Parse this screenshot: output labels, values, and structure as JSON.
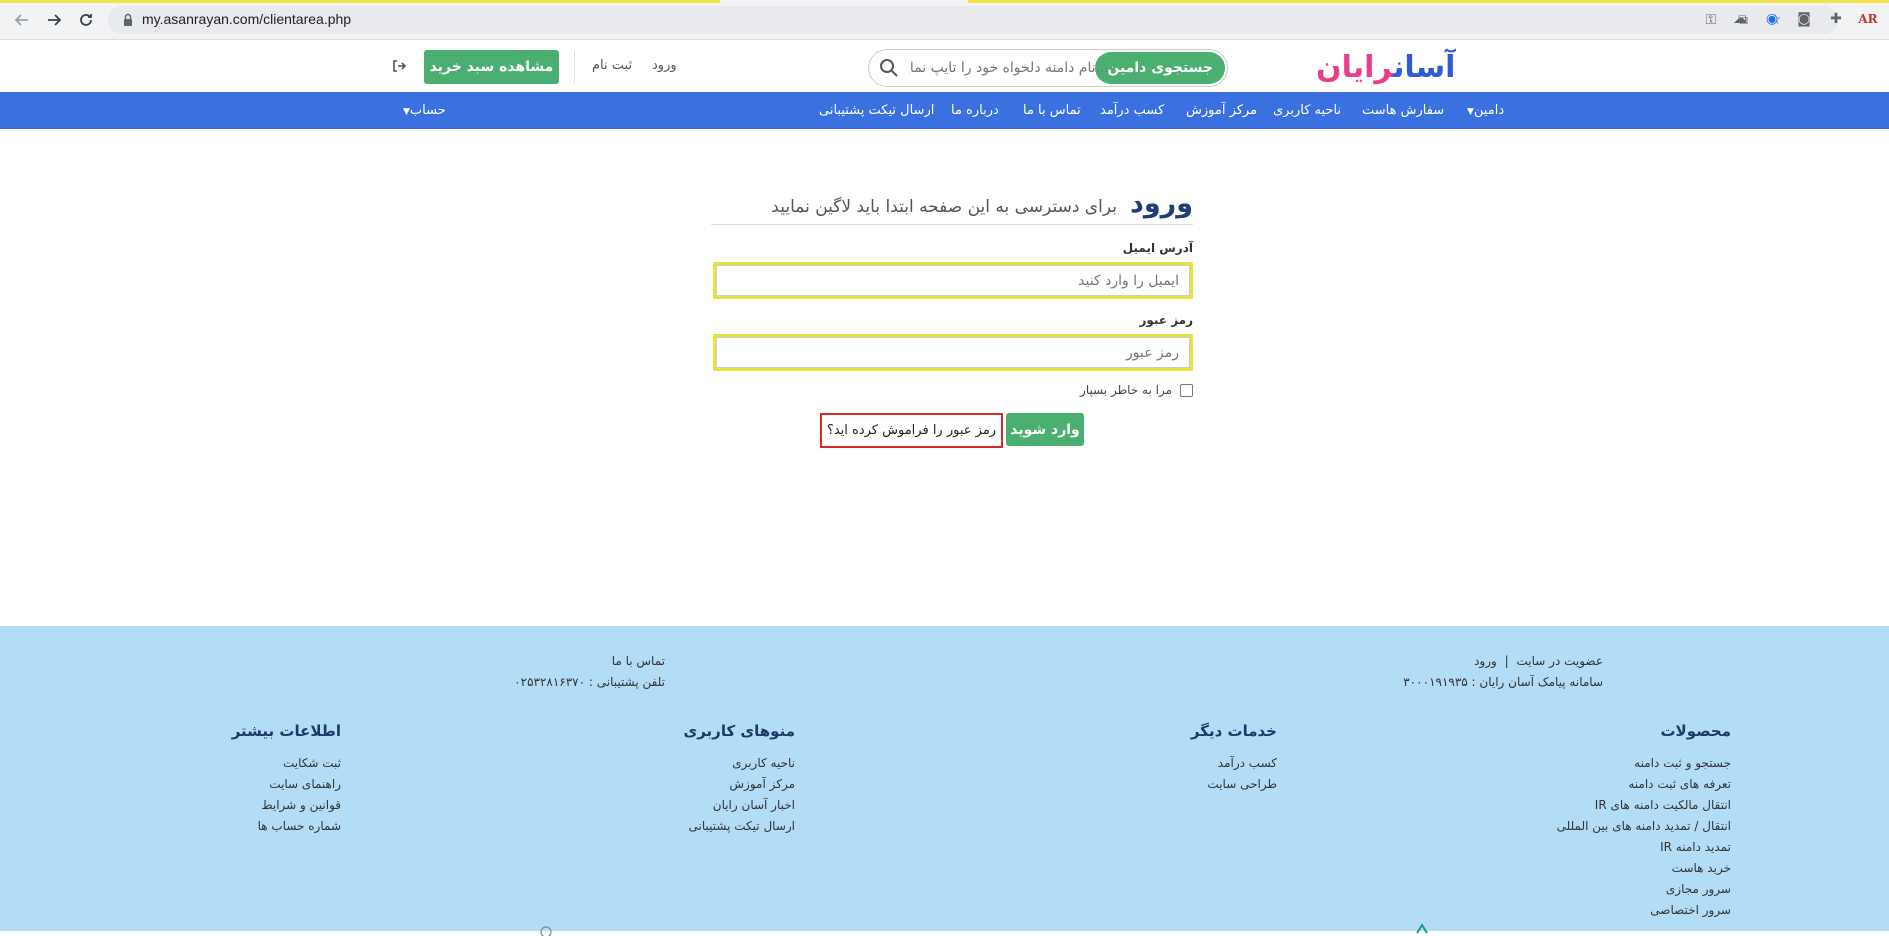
{
  "browser": {
    "url": "my.asanrayan.com/clientarea.php",
    "back_icon": "arrow-left-icon",
    "forward_icon": "arrow-right-icon",
    "reload_icon": "reload-icon"
  },
  "header": {
    "logo_text_main": "آسان",
    "logo_text_accent": "رایان",
    "search_button": "جستجوی دامین",
    "search_placeholder": "...نام دامنه دلخواه خود را تایپ نمایید",
    "login_link": "ورود",
    "register_link": "ثبت نام",
    "cart_button": "مشاهده سبد خرید"
  },
  "nav": {
    "items": [
      {
        "label": "دامین"
      },
      {
        "label": "سفارش هاست"
      },
      {
        "label": "ناحیه کاربری"
      },
      {
        "label": "مرکز آموزش"
      },
      {
        "label": "کسب درآمد"
      },
      {
        "label": "تماس با ما"
      },
      {
        "label": "درباره ما"
      },
      {
        "label": "ارسال تیکت پشتیبانی"
      }
    ],
    "account": "حساب"
  },
  "login": {
    "title": "ورود",
    "subtitle": "برای دسترسی به این صفحه ابتدا باید لاگین نمایید",
    "email_label": "آدرس ایمیل",
    "email_placeholder": "ایمیل را وارد کنید",
    "password_label": "رمز عبور",
    "password_placeholder": "رمز عبور",
    "remember_label": "مرا به خاطر بسپار",
    "submit_button": "وارد شوید",
    "forgot_button": "رمز عبور را فراموش کرده اید؟"
  },
  "footer": {
    "top_right_line1_a": "عضویت در سایت",
    "top_right_sep": "|",
    "top_right_line1_b": "ورود",
    "top_right_line2": "سامانه پیامک آسان رایان : ۳۰۰۰۱۹۱۹۳۵",
    "top_left_line1": "تماس با ما",
    "top_left_line2": "تلفن پشتیبانی : ۰۲۵۳۲۸۱۶۳۷۰",
    "columns": [
      {
        "title": "محصولات",
        "links": [
          "جستجو و ثبت دامنه",
          "تعرفه های ثبت دامنه",
          "انتقال مالکیت دامنه های IR",
          "انتقال / تمدید دامنه های بین المللی",
          "تمدید دامنه IR",
          "خرید هاست",
          "سرور مجازی",
          "سرور اختصاصی"
        ]
      },
      {
        "title": "خدمات دیگر",
        "links": [
          "کسب درآمد",
          "طراحی سایت"
        ]
      },
      {
        "title": "منوهای کاربری",
        "links": [
          "ناحیه کاربری",
          "مرکز آموزش",
          "اخبار آسان رایان",
          "ارسال تیکت پشتیبانی"
        ]
      },
      {
        "title": "اطلاعات بیشتر",
        "links": [
          "ثبت شکایت",
          "راهنمای سایت",
          "قوانین و شرایط",
          "شماره حساب ها"
        ]
      }
    ]
  },
  "colors": {
    "nav_blue": "#3a70e0",
    "brand_green": "#4caf72",
    "footer_bg": "#b3dcf7",
    "highlight_yellow": "#e8e23c",
    "highlight_red": "#d42b2b"
  }
}
